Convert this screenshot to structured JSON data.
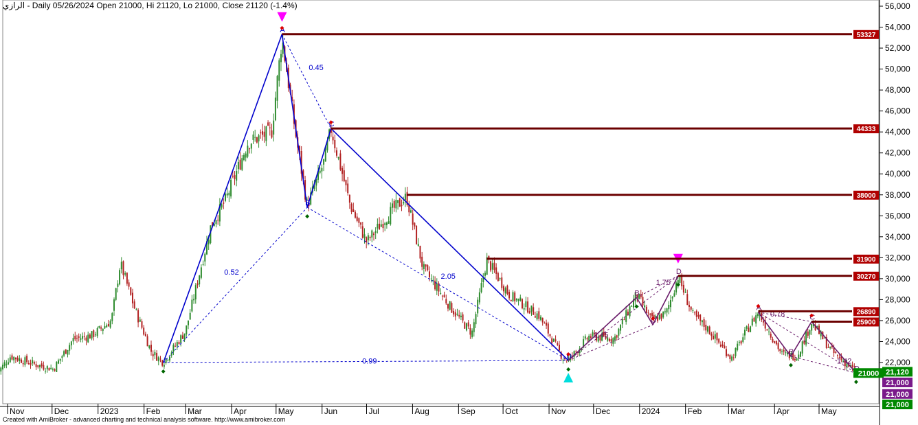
{
  "header": {
    "symbol": "الرازي",
    "info": " - Daily 05/26/2024 Open 21000, Hi 21120, Lo 21000, Close 21120 (-1.4%)"
  },
  "footer": {
    "text": "Created with AmiBroker - advanced charting and technical analysis software. http://www.amibroker.com"
  },
  "colors": {
    "up_candle": "#2e8b2e",
    "down_candle": "#b22222",
    "level_line": "#6b0000",
    "level_label_bg": "#b00000",
    "pattern_blue": "#0000cc",
    "pattern_purple": "#6a1b6a",
    "marker_red": "#dd0000",
    "marker_green": "#006600",
    "triangle_magenta": "#ff00ff",
    "triangle_cyan": "#00dddd",
    "price_green": "#008800",
    "price_purple": "#7a1a8a"
  },
  "chart_data": {
    "type": "candlestick",
    "title": "الرازي - Daily 05/26/2024",
    "y_axis": {
      "side": "right",
      "ylim": [
        19500,
        56800
      ],
      "ticks": [
        "22,000",
        "24,000",
        "26,000",
        "28,000",
        "30,000",
        "32,000",
        "34,000",
        "36,000",
        "38,000",
        "40,000",
        "42,000",
        "44,000",
        "46,000",
        "48,000",
        "50,000",
        "52,000",
        "54,000",
        "56,000"
      ]
    },
    "x_axis": {
      "tick_labels": [
        "Nov",
        "Dec",
        "2023",
        "Feb",
        "Mar",
        "Apr",
        "May",
        "Jun",
        "Jul",
        "Aug",
        "Sep",
        "Oct",
        "Nov",
        "Dec",
        "2024",
        "Feb",
        "Mar",
        "Apr",
        "May"
      ],
      "tick_dates": [
        "2022-11-01",
        "2022-12-01",
        "2023-01-01",
        "2023-02-01",
        "2023-03-01",
        "2023-04-01",
        "2023-05-01",
        "2023-06-01",
        "2023-07-01",
        "2023-08-01",
        "2023-09-01",
        "2023-10-01",
        "2023-11-01",
        "2023-12-01",
        "2024-01-01",
        "2024-02-01",
        "2024-03-01",
        "2024-04-01",
        "2024-05-01"
      ]
    },
    "price_path": [
      {
        "date": "2022-10-25",
        "price": 21000
      },
      {
        "date": "2022-11-03",
        "price": 22600
      },
      {
        "date": "2022-11-20",
        "price": 21800
      },
      {
        "date": "2022-12-02",
        "price": 21400
      },
      {
        "date": "2022-12-15",
        "price": 24200
      },
      {
        "date": "2022-12-28",
        "price": 24600
      },
      {
        "date": "2023-01-10",
        "price": 26000
      },
      {
        "date": "2023-01-16",
        "price": 31500
      },
      {
        "date": "2023-01-26",
        "price": 27000
      },
      {
        "date": "2023-02-06",
        "price": 23000
      },
      {
        "date": "2023-02-14",
        "price": 22000
      },
      {
        "date": "2023-03-01",
        "price": 25000
      },
      {
        "date": "2023-03-18",
        "price": 35000
      },
      {
        "date": "2023-03-28",
        "price": 37500
      },
      {
        "date": "2023-04-12",
        "price": 43000
      },
      {
        "date": "2023-04-28",
        "price": 44000
      },
      {
        "date": "2023-05-05",
        "price": 53000
      },
      {
        "date": "2023-05-15",
        "price": 43000
      },
      {
        "date": "2023-05-22",
        "price": 37000
      },
      {
        "date": "2023-06-02",
        "price": 41000
      },
      {
        "date": "2023-06-07",
        "price": 44300
      },
      {
        "date": "2023-06-20",
        "price": 37000
      },
      {
        "date": "2023-07-01",
        "price": 33500
      },
      {
        "date": "2023-07-18",
        "price": 36500
      },
      {
        "date": "2023-07-28",
        "price": 37800
      },
      {
        "date": "2023-08-08",
        "price": 31000
      },
      {
        "date": "2023-08-28",
        "price": 27000
      },
      {
        "date": "2023-09-10",
        "price": 24800
      },
      {
        "date": "2023-09-20",
        "price": 31800
      },
      {
        "date": "2023-10-05",
        "price": 28500
      },
      {
        "date": "2023-10-25",
        "price": 26500
      },
      {
        "date": "2023-11-10",
        "price": 22500
      },
      {
        "date": "2023-11-14",
        "price": 22200
      },
      {
        "date": "2023-11-28",
        "price": 24500
      },
      {
        "date": "2023-12-15",
        "price": 24300
      },
      {
        "date": "2023-12-30",
        "price": 28500
      },
      {
        "date": "2024-01-09",
        "price": 26000
      },
      {
        "date": "2024-01-19",
        "price": 26700
      },
      {
        "date": "2024-01-27",
        "price": 30200
      },
      {
        "date": "2024-02-06",
        "price": 26500
      },
      {
        "date": "2024-02-16",
        "price": 25200
      },
      {
        "date": "2024-03-03",
        "price": 22400
      },
      {
        "date": "2024-03-13",
        "price": 25000
      },
      {
        "date": "2024-03-21",
        "price": 26800
      },
      {
        "date": "2024-04-06",
        "price": 22800
      },
      {
        "date": "2024-04-16",
        "price": 22600
      },
      {
        "date": "2024-04-26",
        "price": 25800
      },
      {
        "date": "2024-05-10",
        "price": 23000
      },
      {
        "date": "2024-05-26",
        "price": 21120
      }
    ],
    "levels": [
      {
        "price": 53327,
        "label": "53327",
        "start": "2023-05-05"
      },
      {
        "price": 44333,
        "label": "44333",
        "start": "2023-06-07"
      },
      {
        "price": 38000,
        "label": "38000",
        "start": "2023-07-28"
      },
      {
        "price": 31900,
        "label": "31900",
        "start": "2023-09-20"
      },
      {
        "price": 30270,
        "label": "30270",
        "start": "2024-01-27"
      },
      {
        "price": 26890,
        "label": "26890",
        "start": "2024-03-21"
      },
      {
        "price": 25900,
        "label": "25900",
        "start": "2024-04-26"
      }
    ],
    "pattern_blue": {
      "points": [
        {
          "date": "2023-02-14",
          "price": 22000,
          "label": ""
        },
        {
          "date": "2023-05-05",
          "price": 53327,
          "label": "A"
        },
        {
          "date": "2023-05-22",
          "price": 36800,
          "label": "B"
        },
        {
          "date": "2023-06-07",
          "price": 44333,
          "label": "C"
        },
        {
          "date": "2023-11-14",
          "price": 22200,
          "label": "D"
        }
      ],
      "ratios": [
        {
          "date": "2023-05-28",
          "price": 49900,
          "text": "0.45"
        },
        {
          "date": "2023-04-01",
          "price": 30400,
          "text": "0.52"
        },
        {
          "date": "2023-07-03",
          "price": 21900,
          "text": "0.99"
        },
        {
          "date": "2023-08-25",
          "price": 30000,
          "text": "2.05"
        }
      ]
    },
    "pattern_purple_1": {
      "points": [
        {
          "date": "2023-11-14",
          "price": 22200,
          "label": ""
        },
        {
          "date": "2023-12-30",
          "price": 28200,
          "label": "B"
        },
        {
          "date": "2024-01-10",
          "price": 25600,
          "label": "C"
        },
        {
          "date": "2024-01-27",
          "price": 30270,
          "label": "D"
        }
      ],
      "ratios": [
        {
          "date": "2024-01-17",
          "price": 29400,
          "text": "1.75"
        },
        {
          "date": "2023-12-06",
          "price": 24400,
          "text": "1.45"
        }
      ]
    },
    "pattern_purple_2": {
      "points": [
        {
          "date": "2024-03-21",
          "price": 26800,
          "label": "A"
        },
        {
          "date": "2024-04-12",
          "price": 22600,
          "label": "B"
        },
        {
          "date": "2024-04-26",
          "price": 25900,
          "label": "C"
        },
        {
          "date": "2024-05-26",
          "price": 21000,
          "label": "D"
        }
      ],
      "ratios": [
        {
          "date": "2024-04-03",
          "price": 26400,
          "text": "0.78"
        },
        {
          "date": "2024-05-18",
          "price": 21900,
          "text": "1.42"
        }
      ]
    },
    "price_labels": [
      {
        "text": "21,120",
        "price": 21120,
        "color": "price_green"
      },
      {
        "text": "21000",
        "price": 21000,
        "color": "price_green",
        "offset_col": -1
      },
      {
        "text": "21,000",
        "price": 20100,
        "color": "price_purple"
      },
      {
        "text": "21,000",
        "price": 19000,
        "color": "price_purple"
      },
      {
        "text": "21,000",
        "price": 18000,
        "color": "price_green"
      }
    ]
  }
}
